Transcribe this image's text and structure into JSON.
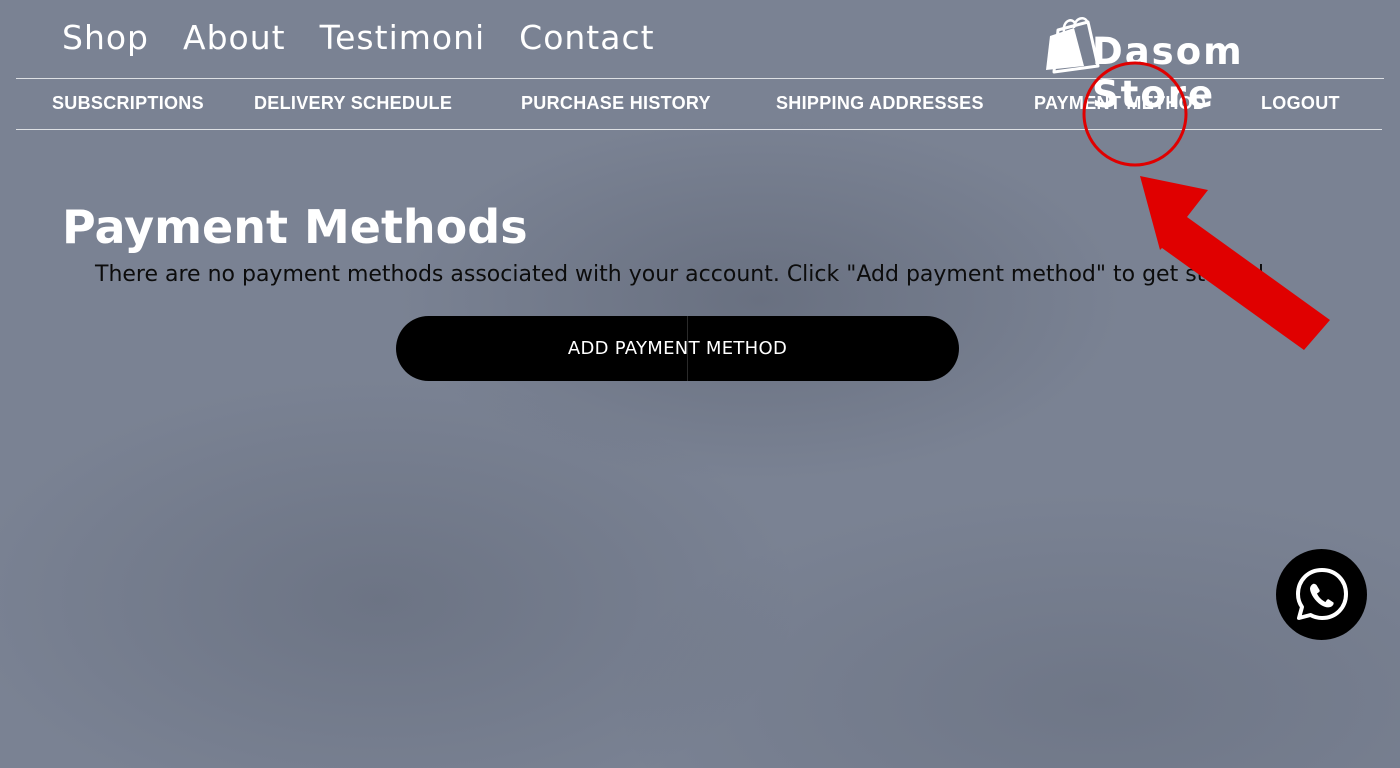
{
  "brand": {
    "name": "Dasom Store",
    "icon": "shopping-bag-icon"
  },
  "top_nav": {
    "items": [
      {
        "label": "Shop"
      },
      {
        "label": "About"
      },
      {
        "label": "Testimoni"
      },
      {
        "label": "Contact"
      }
    ]
  },
  "account_nav": {
    "items": [
      {
        "label": "SUBSCRIPTIONS"
      },
      {
        "label": "DELIVERY SCHEDULE"
      },
      {
        "label": "PURCHASE HISTORY"
      },
      {
        "label": "SHIPPING ADDRESSES"
      },
      {
        "label": "PAYMENT METHOD"
      },
      {
        "label": "LOGOUT"
      }
    ]
  },
  "main": {
    "title": "Payment Methods",
    "empty_message": "There are no payment methods associated with your account. Click \"Add payment method\" to get started",
    "add_button_label": "ADD PAYMENT METHOD"
  },
  "floating": {
    "whatsapp_icon": "whatsapp-icon"
  },
  "colors": {
    "background": "#7a8293",
    "button": "#000000",
    "annotation": "#e00000"
  }
}
